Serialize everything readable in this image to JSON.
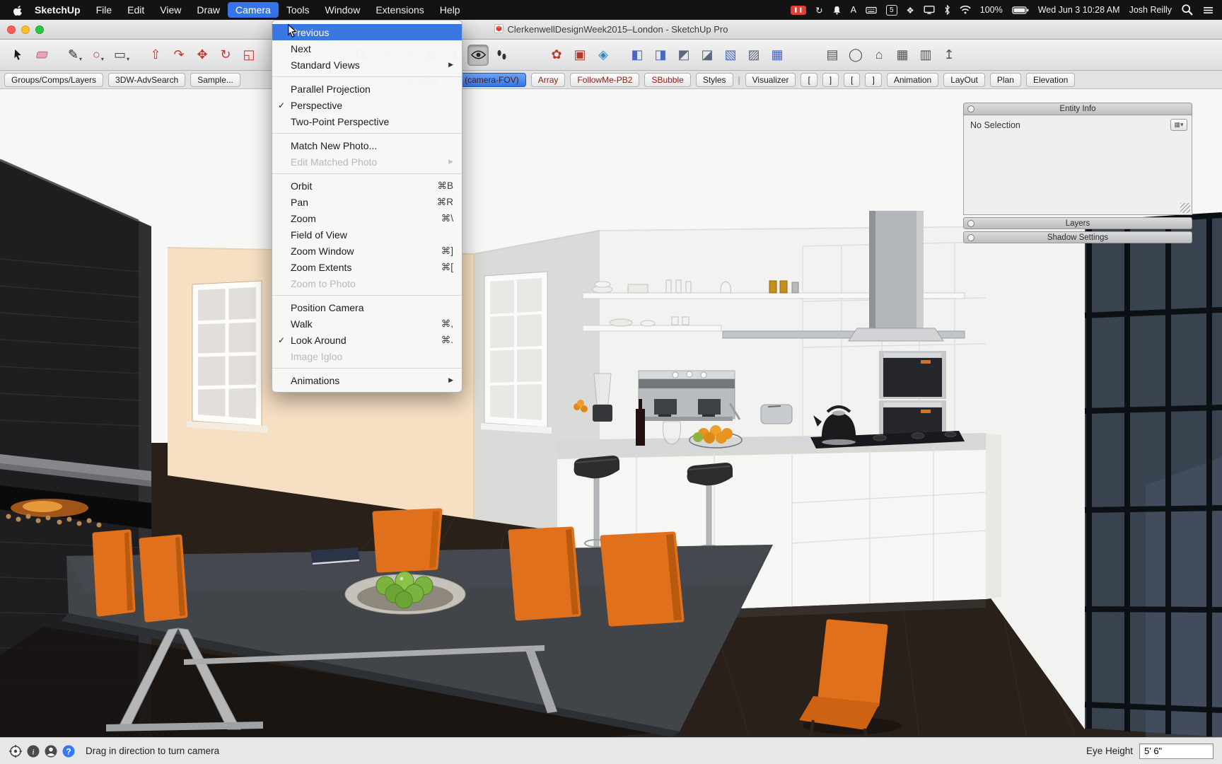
{
  "menubar": {
    "items": [
      {
        "label": "SketchUp",
        "bold": true
      },
      {
        "label": "File"
      },
      {
        "label": "Edit"
      },
      {
        "label": "View"
      },
      {
        "label": "Draw"
      },
      {
        "label": "Camera",
        "active": true
      },
      {
        "label": "Tools"
      },
      {
        "label": "Window"
      },
      {
        "label": "Extensions"
      },
      {
        "label": "Help"
      }
    ],
    "status_icons": [
      {
        "name": "screen-recording-icon",
        "kind": "record"
      },
      {
        "name": "time-machine-icon",
        "kind": "glyph",
        "glyph": "↻"
      },
      {
        "name": "notification-bell-icon",
        "kind": "svg",
        "svg": "bell"
      },
      {
        "name": "text-format-icon",
        "kind": "text",
        "value": "A"
      },
      {
        "name": "keyboard-icon",
        "kind": "svg",
        "svg": "keyboard"
      },
      {
        "name": "badge-5-icon",
        "kind": "boxtext",
        "value": "5"
      },
      {
        "name": "game-center-icon",
        "kind": "glyph",
        "glyph": "❖"
      },
      {
        "name": "display-icon",
        "kind": "svg",
        "svg": "display"
      },
      {
        "name": "bluetooth-icon",
        "kind": "svg",
        "svg": "bluetooth"
      },
      {
        "name": "wifi-icon",
        "kind": "svg",
        "svg": "wifi"
      },
      {
        "name": "battery-percent",
        "kind": "text",
        "value": "100%"
      },
      {
        "name": "battery-icon",
        "kind": "svg",
        "svg": "battery"
      },
      {
        "name": "menubar-clock",
        "kind": "text",
        "value": "Wed Jun 3 10:28 AM"
      },
      {
        "name": "fast-user-switch",
        "kind": "text",
        "value": "Josh Reilly"
      },
      {
        "name": "spotlight-icon",
        "kind": "svg",
        "svg": "magnifier"
      },
      {
        "name": "notification-center-icon",
        "kind": "svg",
        "svg": "list"
      }
    ]
  },
  "titlebar": {
    "title": "ClerkenwellDesignWeek2015–London - SketchUp Pro"
  },
  "toolbar": {
    "groups": [
      {
        "icons": [
          {
            "name": "select-tool",
            "svg": "cursor"
          },
          {
            "name": "eraser-tool",
            "svg": "eraser"
          }
        ]
      },
      {
        "icons": [
          {
            "name": "line-tool",
            "glyph": "✎",
            "color": "#222",
            "dropdown": true
          },
          {
            "name": "circle-tool",
            "glyph": "○",
            "color": "#c0392b",
            "dropdown": true
          },
          {
            "name": "rectangle-tool",
            "glyph": "▭",
            "color": "#444",
            "dropdown": true
          }
        ]
      },
      {
        "icons": [
          {
            "name": "push-pull-tool",
            "glyph": "⇧",
            "color": "#c0392b"
          },
          {
            "name": "follow-me-tool",
            "glyph": "↷",
            "color": "#c0392b"
          },
          {
            "name": "move-tool",
            "glyph": "✥",
            "color": "#c0392b"
          },
          {
            "name": "rotate-tool",
            "glyph": "↻",
            "color": "#c0392b"
          },
          {
            "name": "scale-tool",
            "glyph": "◱",
            "color": "#c0392b"
          }
        ]
      },
      {
        "icons": [
          {
            "name": "tape-measure-tool",
            "glyph": "╱",
            "color": "#555"
          },
          {
            "name": "protractor-tool",
            "glyph": "∠",
            "color": "#555"
          }
        ]
      },
      {
        "gap": "lg",
        "icons": [
          {
            "name": "zoom-tool",
            "svg": "magnifier"
          },
          {
            "name": "orbit-tool",
            "glyph": "↺",
            "color": "#b03a2e"
          },
          {
            "name": "pan-tool",
            "glyph": "✛",
            "color": "#333"
          },
          {
            "name": "zoom-extents-tool",
            "glyph": "▣",
            "color": "#333"
          },
          {
            "name": "position-camera-tool",
            "glyph": "♟",
            "color": "#333"
          },
          {
            "name": "look-around-tool",
            "svg": "eye",
            "pressed": true
          },
          {
            "name": "walk-tool",
            "svg": "footprints"
          }
        ]
      },
      {
        "gap": "lg",
        "icons": [
          {
            "name": "plugin-icon-1",
            "glyph": "✿",
            "color": "#c0392b"
          },
          {
            "name": "plugin-icon-2",
            "glyph": "▣",
            "color": "#b03a2e"
          },
          {
            "name": "plugin-icon-3",
            "glyph": "◈",
            "color": "#2e86c1"
          }
        ]
      },
      {
        "icons": [
          {
            "name": "cube-plugin-icon-1",
            "glyph": "◧",
            "color": "#4a69bd"
          },
          {
            "name": "cube-plugin-icon-2",
            "glyph": "◨",
            "color": "#4a69bd"
          },
          {
            "name": "cube-plugin-icon-3",
            "glyph": "◩",
            "color": "#5a6a7a"
          },
          {
            "name": "cube-plugin-icon-4",
            "glyph": "◪",
            "color": "#5a6a7a"
          },
          {
            "name": "cube-plugin-icon-5",
            "glyph": "▧",
            "color": "#4a69bd"
          },
          {
            "name": "cube-plugin-icon-6",
            "glyph": "▨",
            "color": "#5a6a7a"
          },
          {
            "name": "cube-plugin-icon-7",
            "glyph": "▦",
            "color": "#4a69bd"
          }
        ]
      },
      {
        "gap": "lg",
        "icons": [
          {
            "name": "section-icon",
            "glyph": "▤",
            "color": "#555"
          },
          {
            "name": "cylinder-icon",
            "glyph": "◯",
            "color": "#555"
          },
          {
            "name": "home-icon",
            "glyph": "⌂",
            "color": "#555"
          },
          {
            "name": "grid-icon",
            "glyph": "▦",
            "color": "#555"
          },
          {
            "name": "print-icon",
            "glyph": "▥",
            "color": "#555"
          },
          {
            "name": "export-icon",
            "glyph": "↥",
            "color": "#555"
          }
        ]
      }
    ]
  },
  "tabbar": {
    "tabs": [
      {
        "label": "Groups/Comps/Layers"
      },
      {
        "label": "3DW-AdvSearch"
      },
      {
        "label": "Sample..."
      },
      {
        "gap": true
      },
      {
        "label": "Shading"
      },
      {
        "sep": true,
        "label": "|"
      },
      {
        "label": "(camera-FOV)",
        "selected": true
      },
      {
        "label": "Array",
        "red": true
      },
      {
        "label": "FollowMe-PB2",
        "red": true
      },
      {
        "label": "SBubble",
        "red": true
      },
      {
        "label": "Styles"
      },
      {
        "sep": true,
        "label": "|"
      },
      {
        "label": "Visualizer"
      },
      {
        "label": "["
      },
      {
        "label": "]"
      },
      {
        "label": "["
      },
      {
        "label": "]"
      },
      {
        "label": "Animation"
      },
      {
        "label": "LayOut"
      },
      {
        "label": "Plan"
      },
      {
        "label": "Elevation"
      }
    ]
  },
  "camera_menu": {
    "items": [
      {
        "label": "Previous",
        "highlighted": true
      },
      {
        "label": "Next"
      },
      {
        "label": "Standard Views",
        "submenu": true
      },
      {
        "type": "separator"
      },
      {
        "label": "Parallel Projection"
      },
      {
        "label": "Perspective",
        "checked": true
      },
      {
        "label": "Two-Point Perspective"
      },
      {
        "type": "separator"
      },
      {
        "label": "Match New Photo..."
      },
      {
        "label": "Edit Matched Photo",
        "disabled": true,
        "submenu": true
      },
      {
        "type": "separator"
      },
      {
        "label": "Orbit",
        "shortcut": "⌘B"
      },
      {
        "label": "Pan",
        "shortcut": "⌘R"
      },
      {
        "label": "Zoom",
        "shortcut": "⌘\\"
      },
      {
        "label": "Field of View"
      },
      {
        "label": "Zoom Window",
        "shortcut": "⌘]"
      },
      {
        "label": "Zoom Extents",
        "shortcut": "⌘["
      },
      {
        "label": "Zoom to Photo",
        "disabled": true
      },
      {
        "type": "separator"
      },
      {
        "label": "Position Camera"
      },
      {
        "label": "Walk",
        "shortcut": "⌘,"
      },
      {
        "label": "Look Around",
        "checked": true,
        "shortcut": "⌘."
      },
      {
        "label": "Image Igloo",
        "disabled": true
      },
      {
        "type": "separator"
      },
      {
        "label": "Animations",
        "submenu": true
      }
    ]
  },
  "panels": {
    "entity_info": {
      "title": "Entity Info",
      "status": "No Selection"
    },
    "layers": {
      "title": "Layers"
    },
    "shadow_settings": {
      "title": "Shadow Settings"
    }
  },
  "viewport": {
    "colors": {
      "chair_orange": "#e0701c",
      "wall_peach": "#f6dfc3",
      "floor": "#282019",
      "glass_wall": "#39424f"
    }
  },
  "statusbar": {
    "message": "Drag in direction to turn camera",
    "eye_height_label": "Eye Height",
    "eye_height_value": "5' 6\""
  }
}
